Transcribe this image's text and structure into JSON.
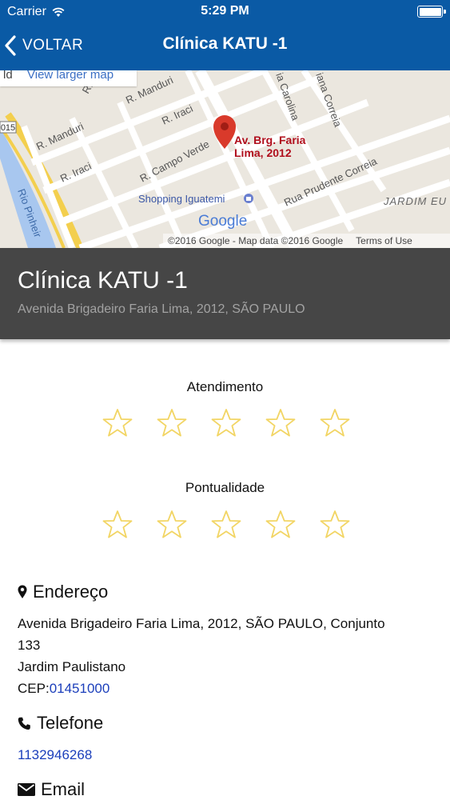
{
  "status_bar": {
    "carrier": "Carrier",
    "time": "5:29 PM"
  },
  "nav": {
    "back_label": "VOLTAR",
    "title": "Clínica KATU -1"
  },
  "map": {
    "view_larger_link": "View larger map",
    "attribution": "©2016 Google - Map data ©2016 Google",
    "terms_link": "Terms of Use",
    "marker_label_line1": "Av. Brg. Faria",
    "marker_label_line2": "Lima, 2012",
    "logo": "Google",
    "streets": {
      "manduri_1": "R. Manduri",
      "manduri_2": "R. Manduri",
      "manduri_3": "R. Manduri",
      "iraci_1": "R. Iraci",
      "iraci_2": "R. Iraci",
      "campo_verde": "R. Campo Verde",
      "carolina": "ia Carolina",
      "correia": "iana Correia",
      "prudente": "Rua Prudente Correia",
      "shopping": "Shopping Iguatemi",
      "jardim": "JARDIM EU",
      "rio": "Rio Pinheir",
      "road_no": "015"
    }
  },
  "clinic": {
    "name": "Clínica KATU -1",
    "address_short": "Avenida Brigadeiro Faria Lima, 2012, SÃO PAULO"
  },
  "ratings": [
    {
      "label": "Atendimento",
      "stars_filled": 0,
      "stars_total": 5
    },
    {
      "label": "Pontualidade",
      "stars_filled": 0,
      "stars_total": 5
    }
  ],
  "address_section": {
    "title": "Endereço",
    "line1": "Avenida Brigadeiro Faria Lima, 2012, SÃO PAULO, Conjunto",
    "line2": "133",
    "line3": "Jardim Paulistano",
    "cep_label": "CEP:",
    "cep_value": "01451000"
  },
  "phone_section": {
    "title": "Telefone",
    "value": "1132946268"
  },
  "email_section": {
    "title": "Email"
  },
  "colors": {
    "header_bg": "#0a5aa5",
    "banner_bg": "#464646",
    "star_outline": "#f2d564",
    "link": "#1c3fbb",
    "marker": "#d93a2b"
  }
}
